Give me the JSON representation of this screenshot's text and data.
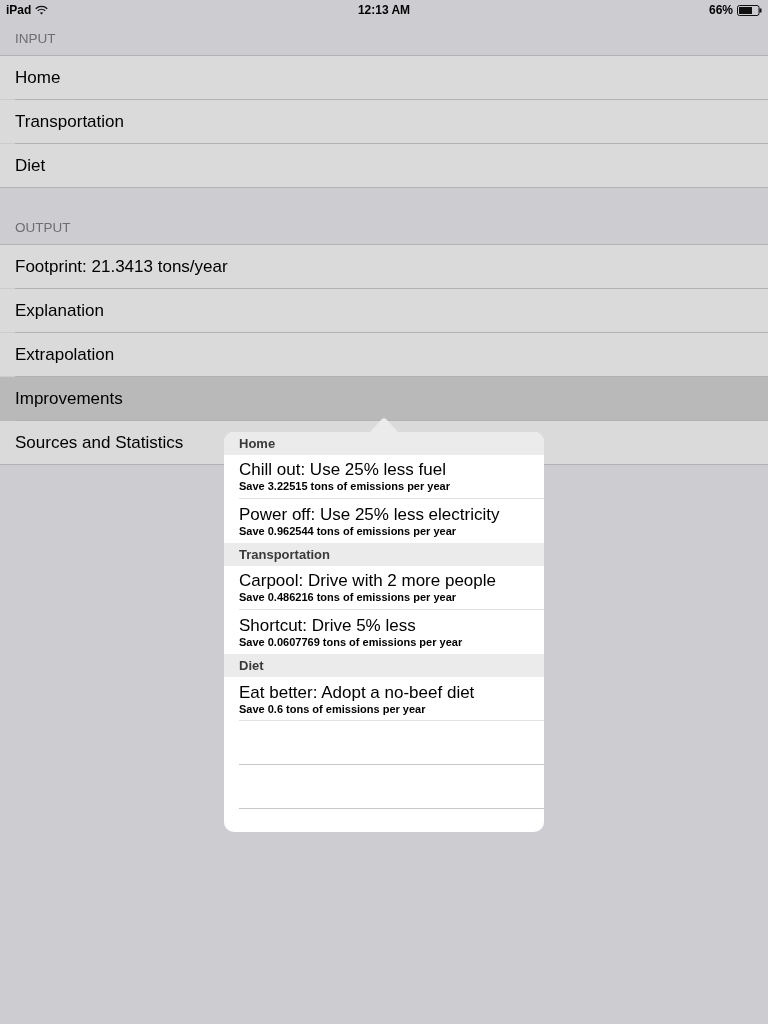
{
  "status_bar": {
    "device": "iPad",
    "time": "12:13 AM",
    "battery": "66%"
  },
  "sections": [
    {
      "header": "INPUT",
      "items": [
        {
          "label": "Home",
          "selected": false
        },
        {
          "label": "Transportation",
          "selected": false
        },
        {
          "label": "Diet",
          "selected": false
        }
      ]
    },
    {
      "header": "OUTPUT",
      "items": [
        {
          "label": "Footprint: 21.3413 tons/year",
          "selected": false
        },
        {
          "label": "Explanation",
          "selected": false
        },
        {
          "label": "Extrapolation",
          "selected": false
        },
        {
          "label": "Improvements",
          "selected": true
        },
        {
          "label": "Sources and Statistics",
          "selected": false
        }
      ]
    }
  ],
  "popover": {
    "sections": [
      {
        "header": "Home",
        "items": [
          {
            "title": "Chill out: Use 25% less fuel",
            "detail": "Save 3.22515 tons of emissions per year"
          },
          {
            "title": "Power off: Use 25% less electricity",
            "detail": "Save 0.962544 tons of emissions per year"
          }
        ]
      },
      {
        "header": "Transportation",
        "items": [
          {
            "title": "Carpool: Drive with 2 more people",
            "detail": "Save 0.486216 tons of emissions per year"
          },
          {
            "title": "Shortcut: Drive 5% less",
            "detail": "Save 0.0607769 tons of emissions per year"
          }
        ]
      },
      {
        "header": "Diet",
        "items": [
          {
            "title": "Eat better: Adopt a no-beef diet",
            "detail": "Save 0.6 tons of emissions per year"
          }
        ]
      }
    ]
  }
}
